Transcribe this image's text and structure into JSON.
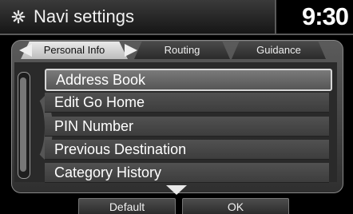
{
  "header": {
    "title": "Navi settings",
    "clock": "9:30",
    "icon": "gear-icon"
  },
  "tabs": [
    {
      "label": "Personal Info",
      "active": true
    },
    {
      "label": "Routing",
      "active": false
    },
    {
      "label": "Guidance",
      "active": false
    }
  ],
  "list": {
    "items": [
      {
        "label": "Address Book",
        "selected": true
      },
      {
        "label": "Edit Go Home",
        "selected": false
      },
      {
        "label": "PIN Number",
        "selected": false
      },
      {
        "label": "Previous Destination",
        "selected": false
      },
      {
        "label": "Category History",
        "selected": false
      }
    ]
  },
  "buttons": {
    "default_label": "Default",
    "ok_label": "OK"
  },
  "icons": {
    "scroll_down": "down-arrow-icon",
    "tab_left": "left-arrow-icon",
    "tab_right": "right-arrow-icon"
  }
}
